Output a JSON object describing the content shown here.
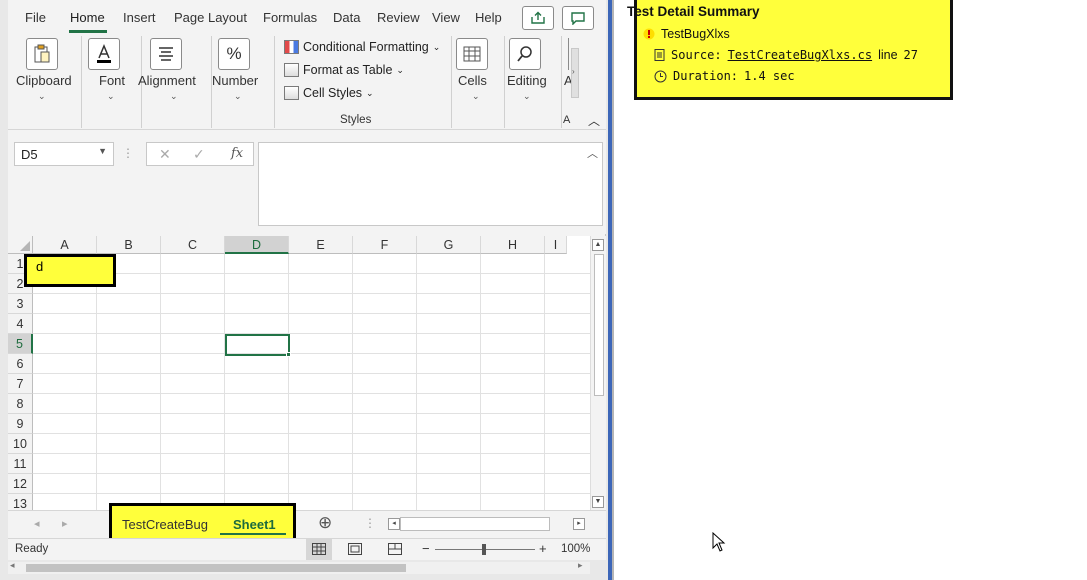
{
  "ribbon_tabs": [
    "File",
    "Home",
    "Insert",
    "Page Layout",
    "Formulas",
    "Data",
    "Review",
    "View",
    "Help"
  ],
  "active_tab": "Home",
  "ribbon": {
    "clipboard": "Clipboard",
    "font": "Font",
    "alignment": "Alignment",
    "number": "Number",
    "number_icon": "%",
    "conditional_formatting": "Conditional Formatting",
    "format_as_table": "Format as Table",
    "cell_styles": "Cell Styles",
    "styles_group": "Styles",
    "cells": "Cells",
    "editing": "Editing",
    "truncated_a1": "A",
    "truncated_a2": "A"
  },
  "formula_bar": {
    "name_box": "D5",
    "fx": "fx",
    "cancel_glyph": "✕",
    "enter_glyph": "✓"
  },
  "columns": [
    "A",
    "B",
    "C",
    "D",
    "E",
    "F",
    "G",
    "H",
    "I"
  ],
  "rows": [
    "1",
    "2",
    "3",
    "4",
    "5",
    "6",
    "7",
    "8",
    "9",
    "10",
    "11",
    "12",
    "13"
  ],
  "selected_cell": "D5",
  "cells": {
    "A1": "d"
  },
  "sheets": [
    "TestCreateBug",
    "Sheet1"
  ],
  "active_sheet": "Sheet1",
  "status": {
    "ready": "Ready",
    "zoom": "100%",
    "minus": "−",
    "plus": "+"
  },
  "test_summary": {
    "title": "Test Detail Summary",
    "test_name": "TestBugXlxs",
    "source_label": "Source:",
    "source_file": "TestCreateBugXlxs.cs",
    "line_label": "line",
    "line_number": "27",
    "duration_label": "Duration:",
    "duration_value": "1.4 sec"
  },
  "colors": {
    "accent": "#217346",
    "highlight": "#ffff3b",
    "window_border": "#3c66b8"
  }
}
